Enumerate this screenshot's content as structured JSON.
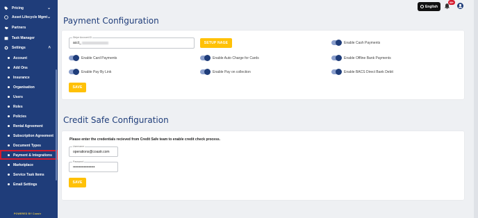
{
  "sidebar": {
    "top_items": [
      {
        "label": "Pricing",
        "icon": "tag-icon"
      },
      {
        "label": "Asset Lifecycle Mgmt",
        "icon": "recycle-icon"
      },
      {
        "label": "Partners",
        "icon": "handshake-icon"
      },
      {
        "label": "Task Manager",
        "icon": "clipboard-icon"
      },
      {
        "label": "Settings",
        "icon": "gear-icon"
      }
    ],
    "settings_items": [
      "Account",
      "Add Ons",
      "Insurance",
      "Organisation",
      "Users",
      "Roles",
      "Policies",
      "Rental Agreement",
      "Subscription Agreement",
      "Document Types",
      "Payment & Integrations",
      "Marketplace",
      "Service Task Items",
      "Email Settings"
    ],
    "active_item": "Payment & Integrations",
    "powered_by": "POWERED BY Coastr"
  },
  "topbar": {
    "language": "English",
    "notification_count": "99+"
  },
  "payment": {
    "title": "Payment Configuration",
    "stripe_label": "Stripe Account ID",
    "stripe_value": "acct_",
    "setup_button": "SETUP NAGE",
    "toggles": [
      {
        "label": "Enable Cash Payments",
        "on": true
      },
      {
        "label": "Enable Card Payments",
        "on": true
      },
      {
        "label": "Enable Auto Charge for Cards",
        "on": true
      },
      {
        "label": "Enable Offline Bank Payments",
        "on": true
      },
      {
        "label": "Enable Pay By Link",
        "on": true
      },
      {
        "label": "Enable Pay on collection",
        "on": true
      },
      {
        "label": "Enable BACS Direct Bank Debit",
        "on": true
      }
    ],
    "save_button": "SAVE"
  },
  "credit_safe": {
    "title": "Credit Safe Configuration",
    "info": "Please enter the credentials recieved from Credit Safe team to enable credit check process.",
    "username_label": "Username",
    "username_value": "operations@coastr.com",
    "password_label": "Password",
    "password_value": "••••••••••••••••••",
    "save_button": "SAVE"
  },
  "colors": {
    "sidebar_bg": "#1f3d7a",
    "accent_yellow": "#ffc107",
    "title_blue": "#1f3d7a",
    "active_outline": "#d51a2e"
  }
}
